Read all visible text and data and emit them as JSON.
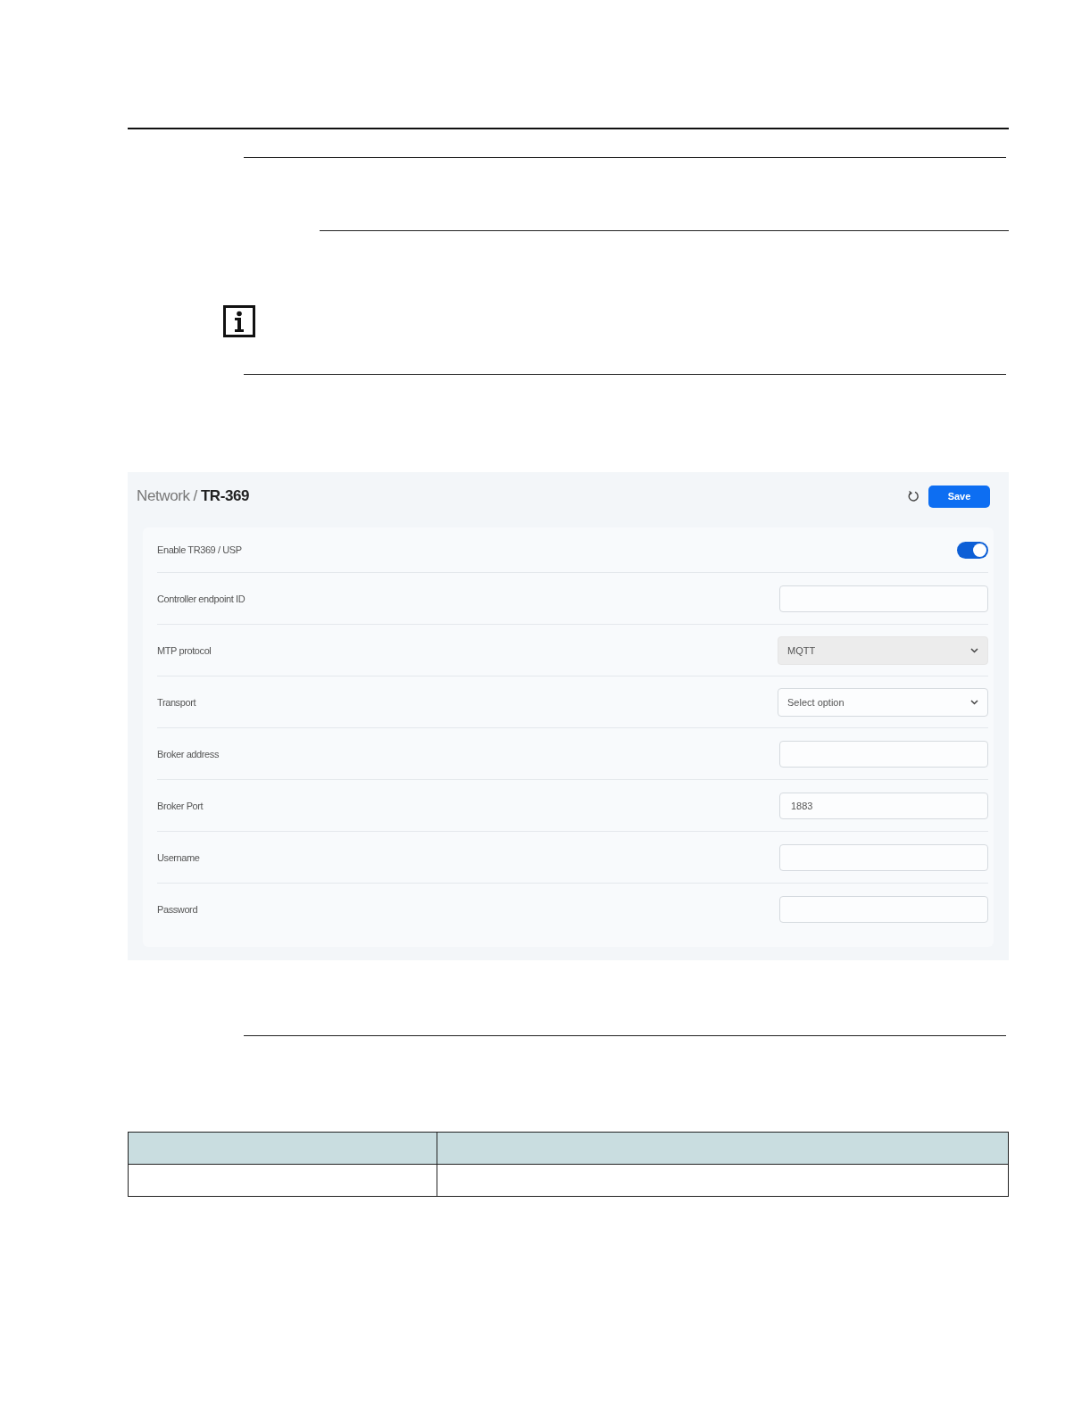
{
  "breadcrumb": {
    "parent": "Network",
    "separator": "/",
    "current": "TR-369"
  },
  "save_button": {
    "label": "Save"
  },
  "settings": [
    {
      "kind": "toggle",
      "label": "Enable TR369 / USP",
      "on": true
    },
    {
      "kind": "input",
      "label": "Controller endpoint ID"
    },
    {
      "kind": "select",
      "label": "MTP protocol",
      "value": "MQTT",
      "disabled": true
    },
    {
      "kind": "select",
      "label": "Transport",
      "placeholder": "Select option",
      "disabled": false
    },
    {
      "kind": "input",
      "label": "Broker address"
    },
    {
      "kind": "input",
      "label": "Broker Port",
      "value": "1883"
    },
    {
      "kind": "input",
      "label": "Username"
    },
    {
      "kind": "input",
      "label": "Password"
    }
  ]
}
